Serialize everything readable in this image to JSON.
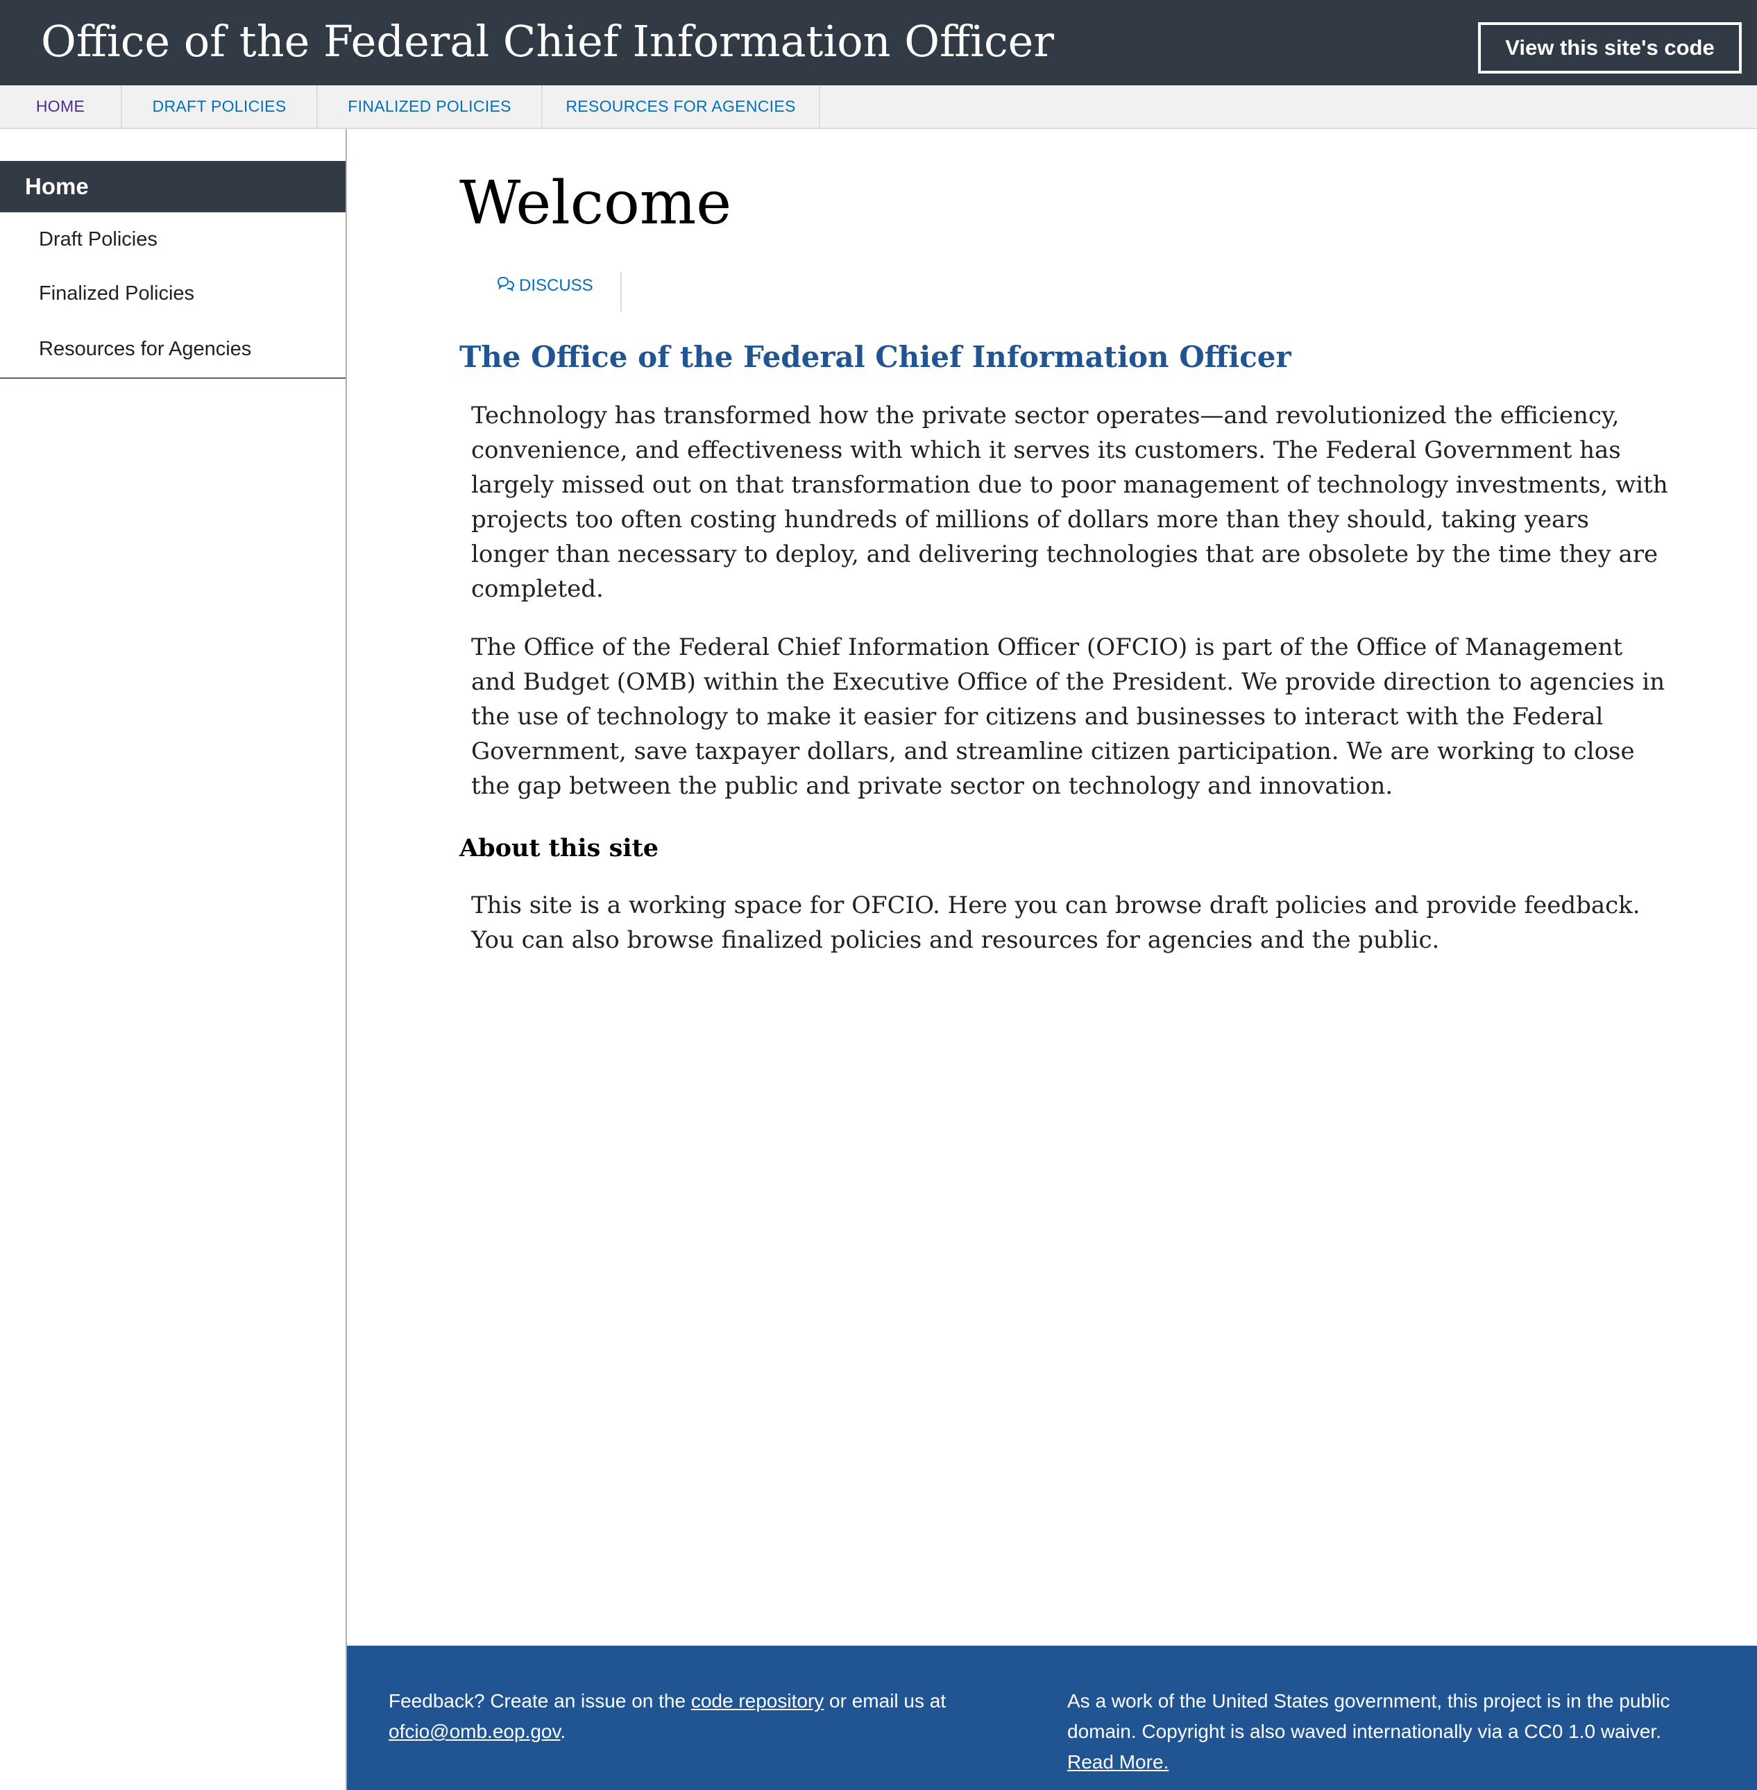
{
  "header": {
    "site_title": "Office of the Federal Chief Information Officer",
    "code_button_label": "View this site's code"
  },
  "top_nav": {
    "items": [
      {
        "label": "HOME"
      },
      {
        "label": "DRAFT POLICIES"
      },
      {
        "label": "FINALIZED POLICIES"
      },
      {
        "label": "RESOURCES FOR AGENCIES"
      }
    ]
  },
  "sidebar": {
    "items": [
      {
        "label": "Home",
        "active": true
      },
      {
        "label": "Draft Policies"
      },
      {
        "label": "Finalized Policies"
      },
      {
        "label": "Resources for Agencies"
      }
    ]
  },
  "main": {
    "page_title": "Welcome",
    "discuss_label": "DISCUSS",
    "discuss_icon": "speech-bubbles-icon",
    "section_heading": "The Office of the Federal Chief Information Officer",
    "paragraphs": [
      "Technology has transformed how the private sector operates—and revolutionized the efficiency, convenience, and effectiveness with which it serves its customers. The Federal Government has largely missed out on that transformation due to poor management of technology investments, with projects too often costing hundreds of millions of dollars more than they should, taking years longer than necessary to deploy, and delivering technologies that are obsolete by the time they are completed.",
      "The Office of the Federal Chief Information Officer (OFCIO) is part of the Office of Management and Budget (OMB) within the Executive Office of the President. We provide direction to agencies in the use of technology to make it easier for citizens and businesses to interact with the Federal Government, save taxpayer dollars, and streamline citizen participation. We are working to close the gap between the public and private sector on technology and innovation."
    ],
    "about_heading": "About this site",
    "about_text": "This site is a working space for OFCIO. Here you can browse draft policies and provide feedback. You can also browse finalized policies and resources for agencies and the public."
  },
  "footer": {
    "left": {
      "prefix": "Feedback? Create an issue on the ",
      "repo_link": "code repository",
      "middle": " or email us at ",
      "email_link": "ofcio@omb.eop.gov",
      "suffix": "."
    },
    "right": {
      "text": "As a work of the United States government, this project is in the public domain. Copyright is also waved internationally via a CC0 1.0 waiver.",
      "read_more_link": "Read More."
    }
  },
  "colors": {
    "header_bg": "#323a45",
    "nav_link": "#0071bc",
    "nav_visited": "#4c2c92",
    "heading_blue": "#205493",
    "footer_bg": "#205493"
  }
}
